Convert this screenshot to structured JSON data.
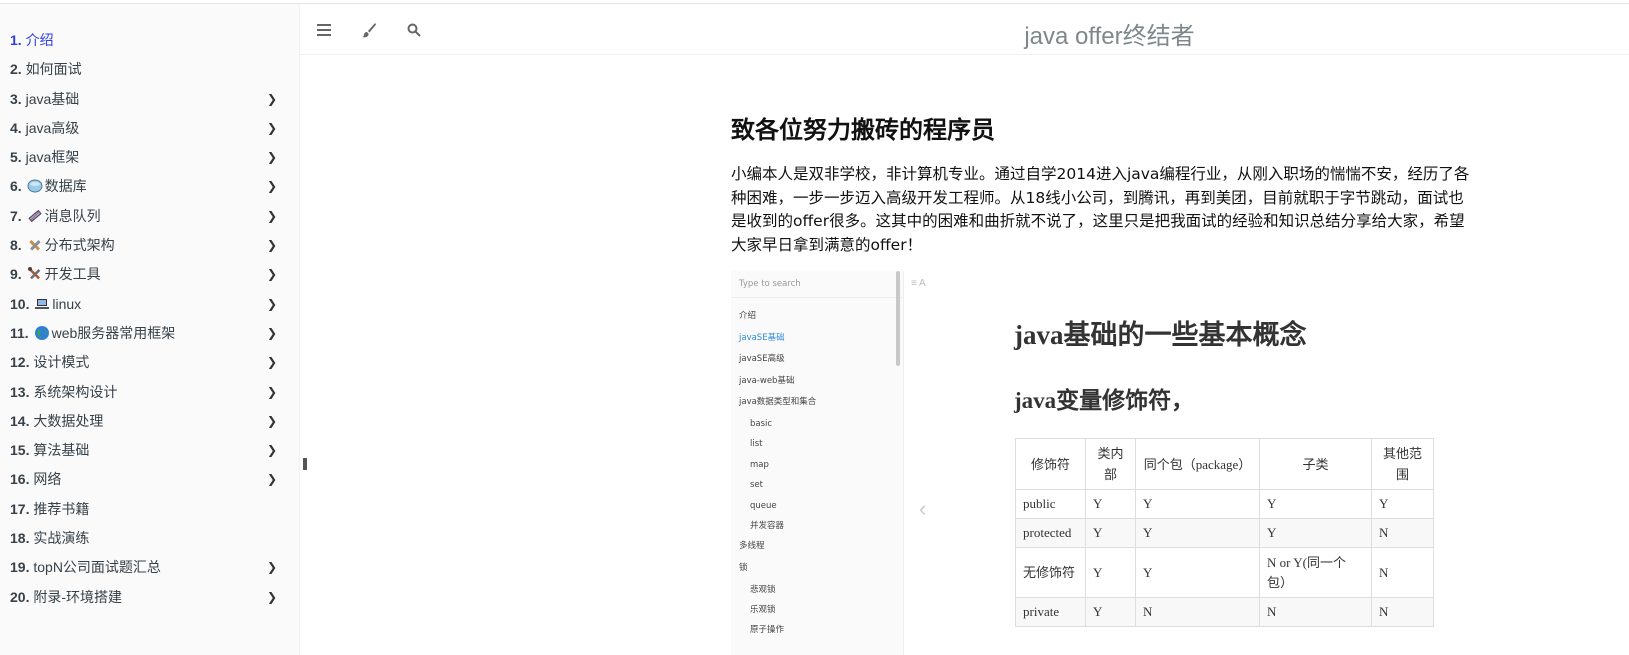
{
  "sidebar": {
    "items": [
      {
        "num": "1.",
        "label": "介绍",
        "emoji": "",
        "has_children": false,
        "active": true
      },
      {
        "num": "2.",
        "label": "如何面试",
        "emoji": "",
        "has_children": false,
        "active": false
      },
      {
        "num": "3.",
        "label": "java基础",
        "emoji": "",
        "has_children": true,
        "active": false
      },
      {
        "num": "4.",
        "label": "java高级",
        "emoji": "",
        "has_children": true,
        "active": false
      },
      {
        "num": "5.",
        "label": "java框架",
        "emoji": "",
        "has_children": true,
        "active": false
      },
      {
        "num": "6.",
        "label": "数据库",
        "emoji": "database-icon",
        "has_children": true,
        "active": false
      },
      {
        "num": "7.",
        "label": "消息队列",
        "emoji": "syringe-icon",
        "has_children": true,
        "active": false
      },
      {
        "num": "8.",
        "label": "分布式架构",
        "emoji": "tools-icon",
        "has_children": true,
        "active": false
      },
      {
        "num": "9.",
        "label": "开发工具",
        "emoji": "crossed-tools-icon",
        "has_children": true,
        "active": false
      },
      {
        "num": "10.",
        "label": "linux",
        "emoji": "laptop-icon",
        "has_children": true,
        "active": false
      },
      {
        "num": "11.",
        "label": "web服务器常用框架",
        "emoji": "globe-icon",
        "has_children": true,
        "active": false
      },
      {
        "num": "12.",
        "label": "设计模式",
        "emoji": "",
        "has_children": true,
        "active": false
      },
      {
        "num": "13.",
        "label": "系统架构设计",
        "emoji": "",
        "has_children": true,
        "active": false
      },
      {
        "num": "14.",
        "label": "大数据处理",
        "emoji": "",
        "has_children": true,
        "active": false
      },
      {
        "num": "15.",
        "label": "算法基础",
        "emoji": "",
        "has_children": true,
        "active": false
      },
      {
        "num": "16.",
        "label": "网络",
        "emoji": "",
        "has_children": true,
        "active": false
      },
      {
        "num": "17.",
        "label": "推荐书籍",
        "emoji": "",
        "has_children": false,
        "active": false
      },
      {
        "num": "18.",
        "label": "实战演练",
        "emoji": "",
        "has_children": false,
        "active": false
      },
      {
        "num": "19.",
        "label": "topN公司面试题汇总",
        "emoji": "",
        "has_children": true,
        "active": false
      },
      {
        "num": "20.",
        "label": "附录-环境搭建",
        "emoji": "",
        "has_children": true,
        "active": false
      }
    ],
    "chevron": "❯"
  },
  "header": {
    "title": "java offer终结者",
    "icons": [
      "menu-icon",
      "brush-icon",
      "search-icon"
    ]
  },
  "main": {
    "heading": "致各位努力搬砖的程序员",
    "paragraph": "小编本人是双非学校，非计算机专业。通过自学2014进入java编程行业，从刚入职场的惴惴不安，经历了各种困难，一步一步迈入高级开发工程师。从18线小公司，到腾讯，再到美团，目前就职于字节跳动，面试也是收到的offer很多。这其中的困难和曲折就不说了，这里只是把我面试的经验和知识总结分享给大家，希望大家早日拿到满意的offer！"
  },
  "screenshot": {
    "search_placeholder": "Type to search",
    "nav": [
      {
        "label": "介绍",
        "sub": false,
        "sel": false
      },
      {
        "label": "javaSE基础",
        "sub": false,
        "sel": true
      },
      {
        "label": "javaSE高级",
        "sub": false,
        "sel": false
      },
      {
        "label": "java-web基础",
        "sub": false,
        "sel": false
      },
      {
        "label": "java数据类型和集合",
        "sub": false,
        "sel": false
      },
      {
        "label": "basic",
        "sub": true,
        "sel": false
      },
      {
        "label": "list",
        "sub": true,
        "sel": false
      },
      {
        "label": "map",
        "sub": true,
        "sel": false
      },
      {
        "label": "set",
        "sub": true,
        "sel": false
      },
      {
        "label": "queue",
        "sub": true,
        "sel": false
      },
      {
        "label": "并发容器",
        "sub": true,
        "sel": false
      },
      {
        "label": "多线程",
        "sub": false,
        "sel": false
      },
      {
        "label": "锁",
        "sub": false,
        "sel": false
      },
      {
        "label": "悲观锁",
        "sub": true,
        "sel": false
      },
      {
        "label": "乐观锁",
        "sub": true,
        "sel": false
      },
      {
        "label": "原子操作",
        "sub": true,
        "sel": false
      }
    ],
    "h1": "java基础的一些基本概念",
    "h2": "java变量修饰符，",
    "toolbar_icons": "≡  A",
    "prev_arrow": "‹",
    "table": {
      "headers": [
        "修饰符",
        "类内部",
        "同个包（package）",
        "子类",
        "其他范围"
      ],
      "rows": [
        [
          "public",
          "Y",
          "Y",
          "Y",
          "Y"
        ],
        [
          "protected",
          "Y",
          "Y",
          "Y",
          "N"
        ],
        [
          "无修饰符",
          "Y",
          "Y",
          "N or Y(同一个包）",
          "N"
        ],
        [
          "private",
          "Y",
          "N",
          "N",
          "N"
        ]
      ]
    }
  }
}
